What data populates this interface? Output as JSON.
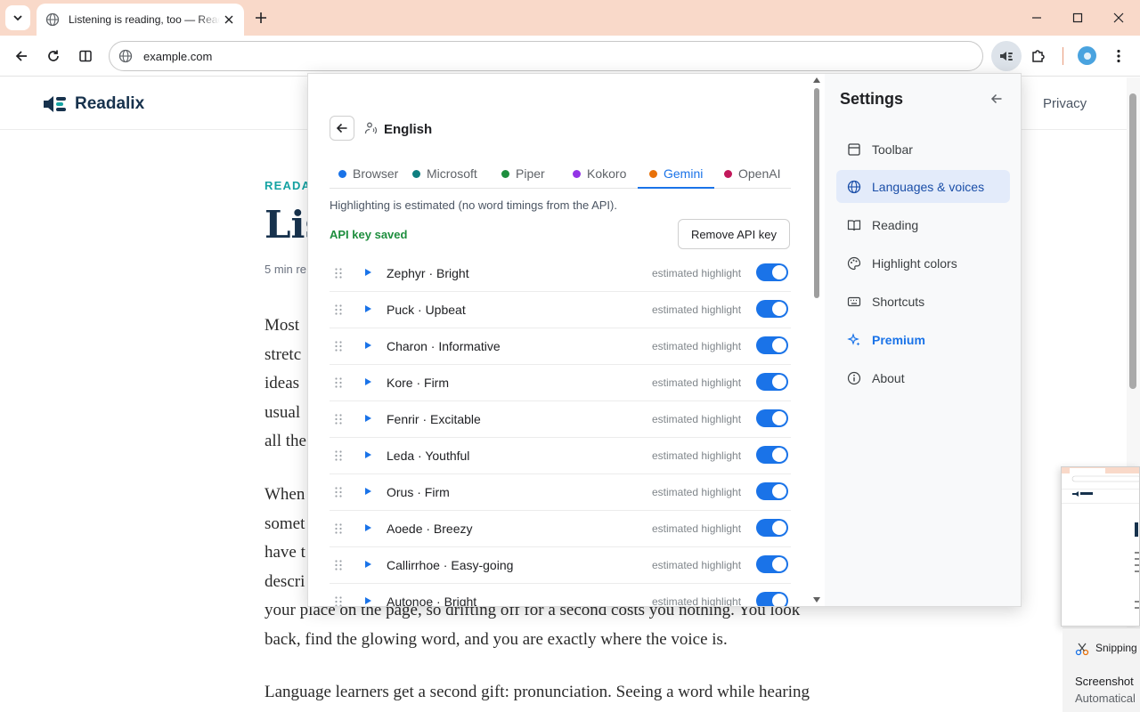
{
  "browser": {
    "tab_title": "Listening is reading, too — Readalix",
    "url": "example.com"
  },
  "page": {
    "brand": "Readalix",
    "nav_privacy": "Privacy",
    "kicker": "READAL",
    "title": "Lis",
    "meta": "5 min re",
    "para1_lines": [
      "Most",
      "stretc",
      "ideas",
      "usual",
      "all the"
    ],
    "para2_lines": [
      "When",
      "somet",
      "have t",
      "descri"
    ],
    "para2_tail": [
      "your place on the page, so drifting off for a second costs you nothing. You look",
      "back, find the glowing word, and you are exactly where the voice is."
    ],
    "para3": "Language learners get a second gift: pronunciation. Seeing a word while hearing"
  },
  "popup": {
    "language": "English",
    "engines": [
      {
        "label": "Browser",
        "color": "#1a73e8"
      },
      {
        "label": "Microsoft",
        "color": "#0f7f80"
      },
      {
        "label": "Piper",
        "color": "#1e8e3e"
      },
      {
        "label": "Kokoro",
        "color": "#9334e6"
      },
      {
        "label": "Gemini",
        "color": "#e8710a"
      },
      {
        "label": "OpenAI",
        "color": "#c2185b"
      }
    ],
    "active_engine": "Gemini",
    "highlight_note": "Highlighting is estimated (no word timings from the API).",
    "api_status": "API key saved",
    "remove_key_label": "Remove API key",
    "voices": [
      {
        "name": "Zephyr · Bright",
        "note": "estimated highlight",
        "enabled": true
      },
      {
        "name": "Puck · Upbeat",
        "note": "estimated highlight",
        "enabled": true
      },
      {
        "name": "Charon · Informative",
        "note": "estimated highlight",
        "enabled": true
      },
      {
        "name": "Kore · Firm",
        "note": "estimated highlight",
        "enabled": true
      },
      {
        "name": "Fenrir · Excitable",
        "note": "estimated highlight",
        "enabled": true
      },
      {
        "name": "Leda · Youthful",
        "note": "estimated highlight",
        "enabled": true
      },
      {
        "name": "Orus · Firm",
        "note": "estimated highlight",
        "enabled": true
      },
      {
        "name": "Aoede · Breezy",
        "note": "estimated highlight",
        "enabled": true
      },
      {
        "name": "Callirrhoe · Easy-going",
        "note": "estimated highlight",
        "enabled": true
      },
      {
        "name": "Autonoe · Bright",
        "note": "estimated highlight",
        "enabled": true
      }
    ]
  },
  "settings": {
    "title": "Settings",
    "items": [
      {
        "label": "Toolbar",
        "icon": "toolbar-icon"
      },
      {
        "label": "Languages & voices",
        "icon": "globe-icon",
        "active": true
      },
      {
        "label": "Reading",
        "icon": "book-icon"
      },
      {
        "label": "Highlight colors",
        "icon": "palette-icon"
      },
      {
        "label": "Shortcuts",
        "icon": "keyboard-icon"
      },
      {
        "label": "Premium",
        "icon": "sparkle-icon",
        "premium": true
      },
      {
        "label": "About",
        "icon": "info-icon"
      }
    ]
  },
  "notification": {
    "app": "Snipping",
    "heading": "Screenshot",
    "sub": "Automatical"
  }
}
